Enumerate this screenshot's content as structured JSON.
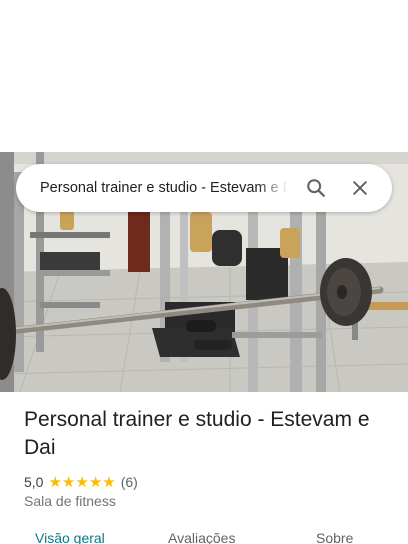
{
  "search": {
    "query": "Personal trainer e studio - Estevam e Dai",
    "search_icon": "search-icon",
    "close_icon": "close-icon"
  },
  "place": {
    "name": "Personal trainer e studio - Estevam e Dai",
    "rating": "5,0",
    "stars": 5,
    "review_count": "(6)",
    "category": "Sala de fitness"
  },
  "tabs": [
    {
      "label": "Visão geral",
      "active": true
    },
    {
      "label": "Avaliações",
      "active": false
    },
    {
      "label": "Sobre",
      "active": false
    }
  ],
  "colors": {
    "star": "#fbbc04",
    "active_tab": "#0b7a8a",
    "text": "#202124"
  }
}
